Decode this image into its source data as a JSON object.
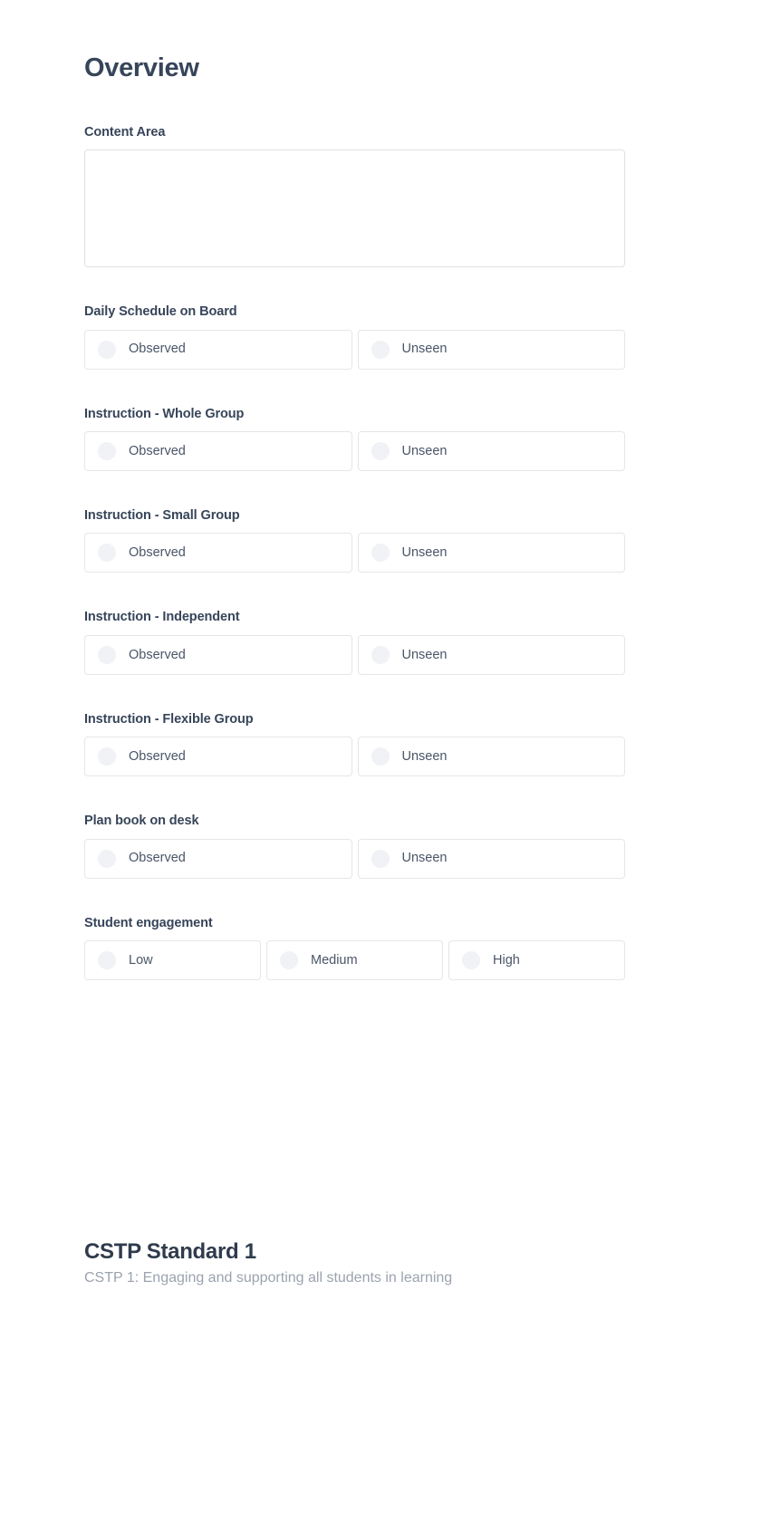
{
  "page": {
    "title": "Overview"
  },
  "content_area": {
    "label": "Content Area",
    "value": "",
    "placeholder": ""
  },
  "observation_options": {
    "observed": "Observed",
    "unseen": "Unseen"
  },
  "fields": [
    {
      "label": "Daily Schedule on Board",
      "options": [
        "Observed",
        "Unseen"
      ],
      "selected": null
    },
    {
      "label": "Instruction - Whole Group",
      "options": [
        "Observed",
        "Unseen"
      ],
      "selected": null
    },
    {
      "label": "Instruction - Small Group",
      "options": [
        "Observed",
        "Unseen"
      ],
      "selected": null
    },
    {
      "label": "Instruction - Independent",
      "options": [
        "Observed",
        "Unseen"
      ],
      "selected": null
    },
    {
      "label": "Instruction - Flexible Group",
      "options": [
        "Observed",
        "Unseen"
      ],
      "selected": null
    },
    {
      "label": "Plan book on desk",
      "options": [
        "Observed",
        "Unseen"
      ],
      "selected": null
    },
    {
      "label": "Student engagement",
      "options": [
        "Low",
        "Medium",
        "High"
      ],
      "selected": null
    }
  ],
  "cstp_section": {
    "title": "CSTP Standard 1",
    "subtitle": "CSTP 1: Engaging and supporting all students in learning"
  },
  "colors": {
    "heading": "#37455a",
    "label": "#37455a",
    "option_text": "#4a5568",
    "border": "#e4e6ea",
    "radio_fill": "#f1f2f5",
    "subtitle": "#9ba3ae",
    "background": "#ffffff"
  }
}
